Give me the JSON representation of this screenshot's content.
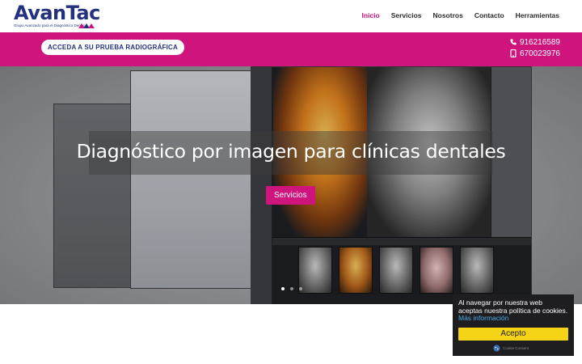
{
  "header": {
    "logo_text": "AvanTac",
    "logo_tagline": "Grupo Avanzado para el Diagnóstico Dental",
    "nav": [
      {
        "label": "Inicio",
        "active": true
      },
      {
        "label": "Servicios",
        "active": false
      },
      {
        "label": "Nosotros",
        "active": false
      },
      {
        "label": "Contacto",
        "active": false
      },
      {
        "label": "Herramientas",
        "active": false
      }
    ]
  },
  "promo_bar": {
    "cta_label": "ACCEDA A SU PRUEBA RADIOGRÁFICA",
    "phone_1": "916216589",
    "phone_2": "670023976",
    "phone_icon": "phone-icon",
    "mobile_icon": "mobile-icon"
  },
  "hero": {
    "title": "Diagnóstico por imagen para clínicas dentales",
    "button_label": "Servicios",
    "slides": 3,
    "active_slide": 1
  },
  "cookie_notice": {
    "text": "Al navegar por nuestra web aceptas nuestra política de cookies.",
    "link_text": "Más información",
    "accept_label": "Acepto",
    "brand": "Cookie Consent"
  },
  "colors": {
    "brand_pink": "#d0147e",
    "brand_navy": "#24317e",
    "cookie_button": "#f5d316"
  }
}
